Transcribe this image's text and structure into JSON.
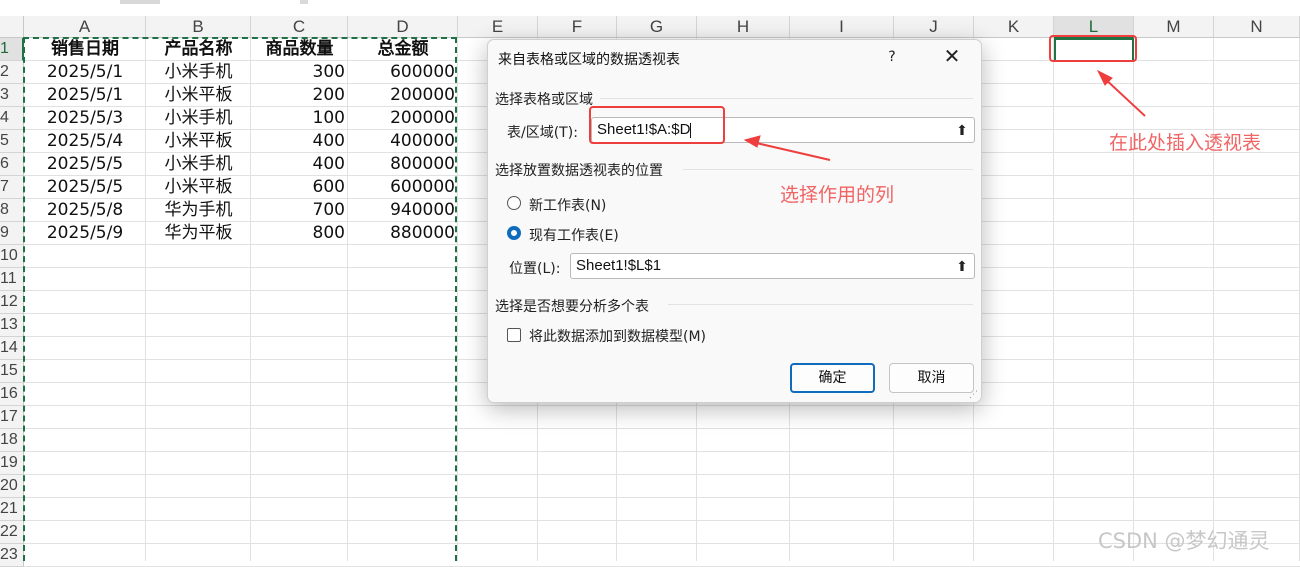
{
  "sheet": {
    "columns": [
      "A",
      "B",
      "C",
      "D",
      "E",
      "F",
      "G",
      "H",
      "I",
      "J",
      "K",
      "L",
      "M",
      "N"
    ],
    "selected_column": "L",
    "rows": [
      "1",
      "2",
      "3",
      "4",
      "5",
      "6",
      "7",
      "8",
      "9",
      "10",
      "11",
      "12",
      "13",
      "14",
      "15",
      "16",
      "17",
      "18",
      "19",
      "20",
      "21",
      "22",
      "23"
    ],
    "selected_row": "1",
    "headers": [
      "销售日期",
      "产品名称",
      "商品数量",
      "总金额"
    ],
    "data": [
      [
        "2025/5/1",
        "小米手机",
        "300",
        "600000"
      ],
      [
        "2025/5/1",
        "小米平板",
        "200",
        "200000"
      ],
      [
        "2025/5/3",
        "小米手机",
        "100",
        "200000"
      ],
      [
        "2025/5/4",
        "小米平板",
        "400",
        "400000"
      ],
      [
        "2025/5/5",
        "小米手机",
        "400",
        "800000"
      ],
      [
        "2025/5/5",
        "小米平板",
        "600",
        "600000"
      ],
      [
        "2025/5/8",
        "华为手机",
        "700",
        "940000"
      ],
      [
        "2025/5/9",
        "华为平板",
        "800",
        "880000"
      ]
    ]
  },
  "dialog": {
    "title": "来自表格或区域的数据透视表",
    "help": "?",
    "close": "✕",
    "section_source": "选择表格或区域",
    "range_label": "表/区域(T):",
    "range_value": "Sheet1!$A:$D",
    "section_location": "选择放置数据透视表的位置",
    "option_new": "新工作表(N)",
    "option_existing": "现有工作表(E)",
    "selected_option": "existing",
    "location_label": "位置(L):",
    "location_value": "Sheet1!$L$1",
    "section_multi": "选择是否想要分析多个表",
    "checkbox_label": "将此数据添加到数据模型(M)",
    "checkbox_checked": false,
    "collapse_icon": "⬆",
    "ok": "确定",
    "cancel": "取消"
  },
  "annotations": {
    "insert_here": "在此处插入透视表",
    "select_columns": "选择作用的列",
    "color": "#ef3e3e"
  },
  "watermark": "CSDN @梦幻通灵",
  "colors": {
    "excel_green": "#217346",
    "accent_blue": "#0f6cbd"
  }
}
